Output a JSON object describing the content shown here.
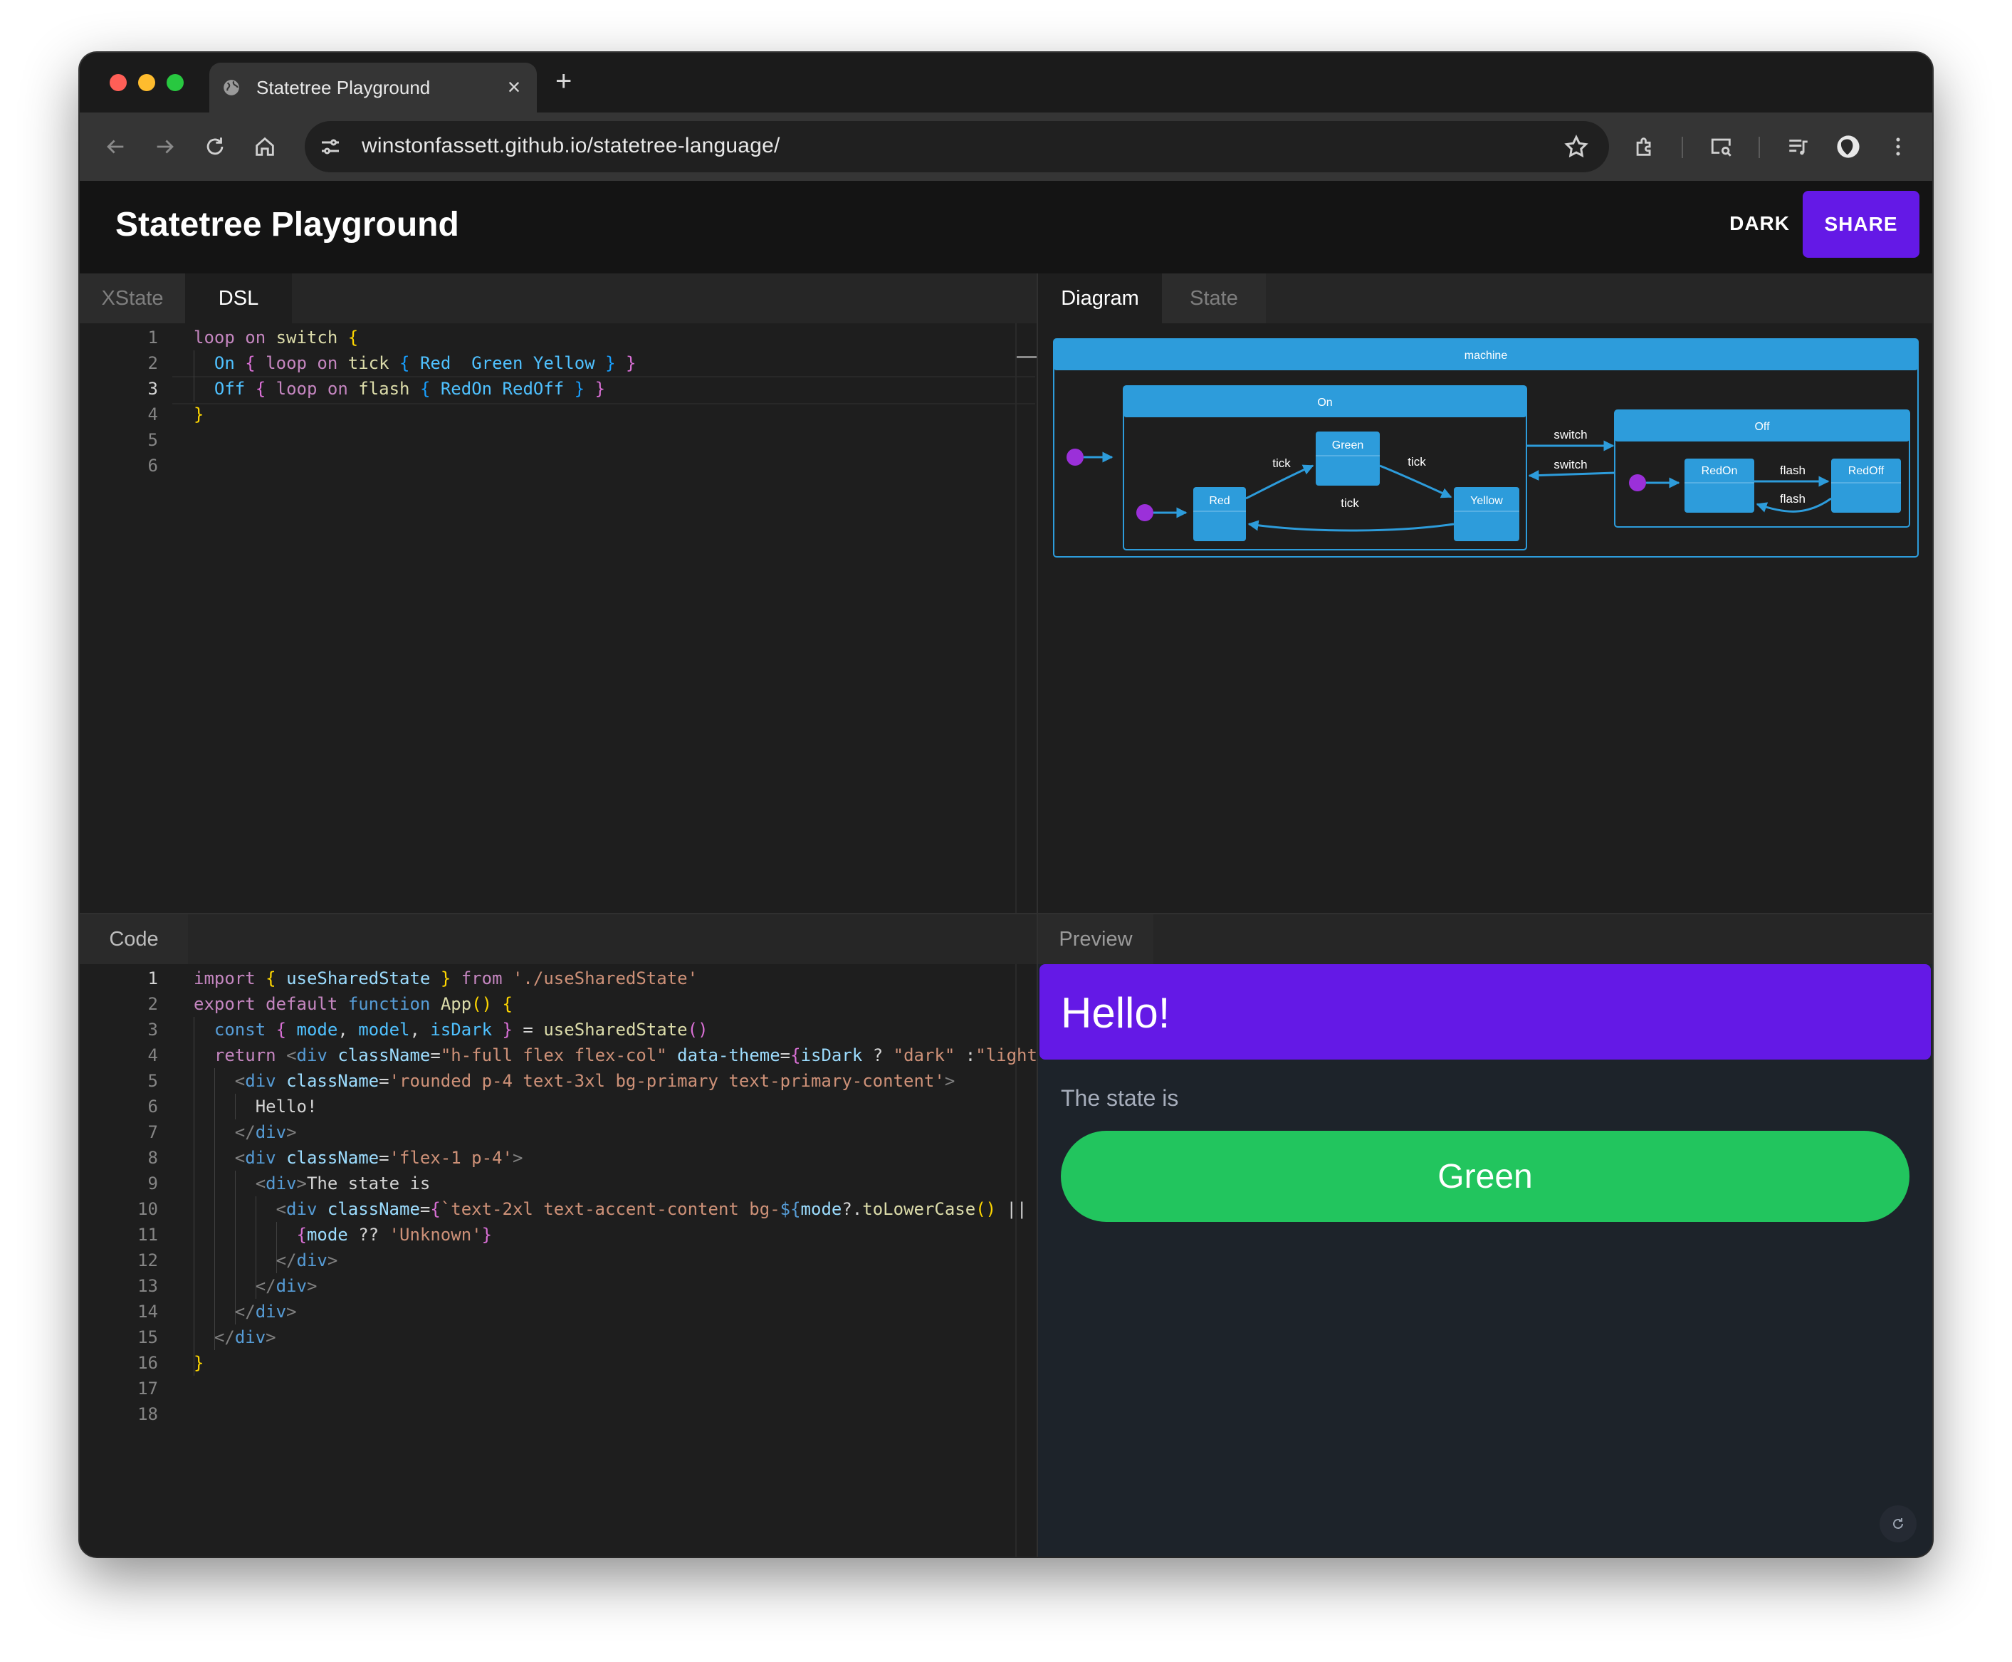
{
  "browser": {
    "tab_title": "Statetree Playground",
    "tab_close": "×",
    "new_tab": "+",
    "url": "winstonfassett.github.io/statetree-language/"
  },
  "app": {
    "title": "Statetree Playground",
    "dark_label": "DARK",
    "share_label": "SHARE"
  },
  "top_left": {
    "tabs": [
      "XState",
      "DSL"
    ],
    "active_tab": "DSL"
  },
  "top_right": {
    "tabs": [
      "Diagram",
      "State"
    ],
    "active_tab": "Diagram"
  },
  "bottom_left": {
    "tab": "Code"
  },
  "bottom_right": {
    "tab": "Preview"
  },
  "dsl_editor": {
    "line_numbers": [
      "1",
      "2",
      "3",
      "4",
      "5",
      "6"
    ],
    "current_line": 3
  },
  "code_editor": {
    "line_numbers": [
      "1",
      "2",
      "3",
      "4",
      "5",
      "6",
      "7",
      "8",
      "9",
      "10",
      "11",
      "12",
      "13",
      "14",
      "15",
      "16",
      "17",
      "18"
    ],
    "current_line": 1
  },
  "diagram": {
    "machine_label": "machine",
    "on_label": "On",
    "off_label": "Off",
    "states": [
      "Green",
      "Red",
      "Yellow",
      "RedOn",
      "RedOff"
    ],
    "events": {
      "tick": "tick",
      "switch": "switch",
      "flash": "flash"
    },
    "colors": {
      "node": "#2d9cdb",
      "initial": "#9b30d9",
      "edge": "#2d9cdb"
    }
  },
  "preview": {
    "hello": "Hello!",
    "state_label": "The state is",
    "state_value": "Green",
    "colors": {
      "primary": "#6419e6",
      "accent": "#22c55e"
    }
  }
}
